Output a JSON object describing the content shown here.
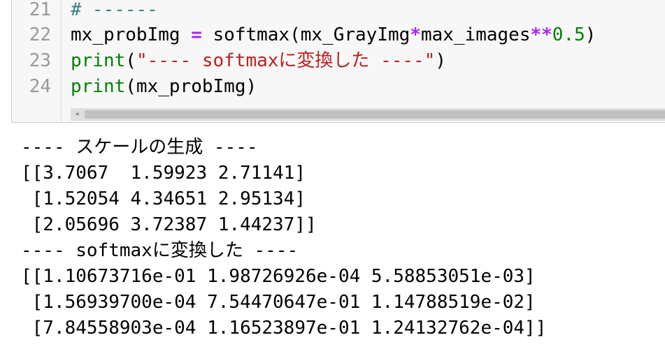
{
  "cell": {
    "line_numbers": [
      "21",
      "22",
      "23",
      "24"
    ],
    "lines": {
      "l21": {
        "comment": "# ------"
      },
      "l22": {
        "lhs": "mx_probImg",
        "eq": " = ",
        "fn": "softmax(mx_GrayImg",
        "op1": "*",
        "mid": "max_images",
        "op2": "**",
        "num": "0.5",
        "close": ")"
      },
      "l23": {
        "fn": "print",
        "open": "(",
        "str": "\"---- softmaxに変換した ----\"",
        "close": ")"
      },
      "l24": {
        "fn": "print",
        "rest": "(mx_probImg)"
      }
    }
  },
  "output": {
    "lines": [
      "---- スケールの生成 ----",
      "[[3.7067  1.59923 2.71141]",
      " [1.52054 4.34651 2.95134]",
      " [2.05696 3.72387 1.44237]]",
      "---- softmaxに変換した ----",
      "[[1.10673716e-01 1.98726926e-04 5.58853051e-03]",
      " [1.56939700e-04 7.54470647e-01 1.14788519e-02]",
      " [7.84558903e-04 1.16523897e-01 1.24132762e-04]]"
    ]
  },
  "icons": {
    "scroll_left": "◂"
  }
}
